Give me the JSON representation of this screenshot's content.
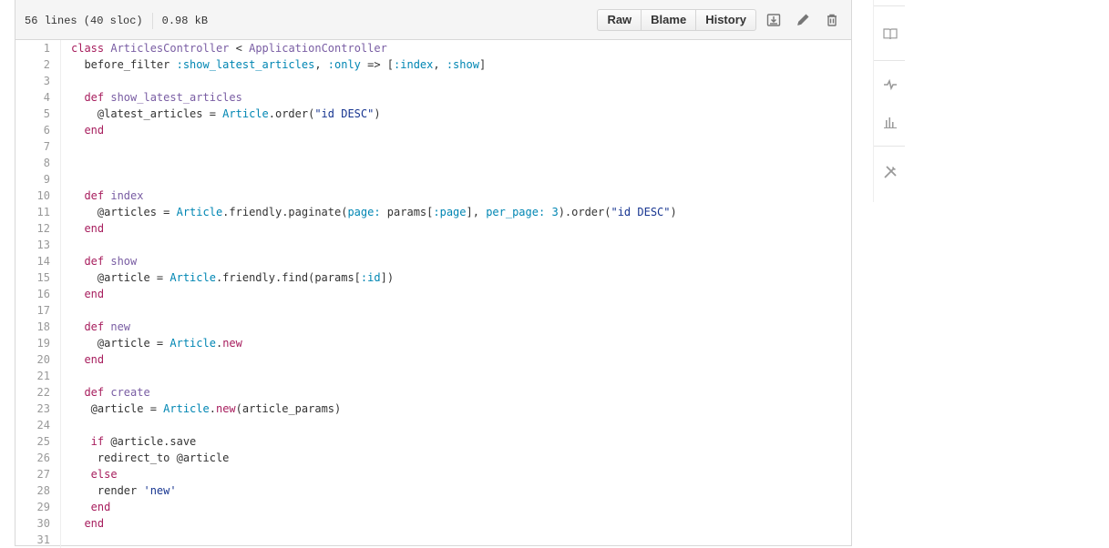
{
  "file_header": {
    "lines_info": "56 lines (40 sloc)",
    "size": "0.98 kB",
    "buttons": {
      "raw": "Raw",
      "blame": "Blame",
      "history": "History"
    },
    "icons": [
      "download-icon",
      "pencil-icon",
      "trash-icon"
    ]
  },
  "code_lines": [
    [
      [
        "k",
        "class "
      ],
      [
        "c",
        "ArticlesController"
      ],
      [
        "",
        " < "
      ],
      [
        "c",
        "ApplicationController"
      ]
    ],
    [
      [
        "",
        "  before_filter "
      ],
      [
        "con",
        ":show_latest_articles"
      ],
      [
        "",
        ", "
      ],
      [
        "con",
        ":only"
      ],
      [
        "",
        " => ["
      ],
      [
        "con",
        ":index"
      ],
      [
        "",
        ", "
      ],
      [
        "con",
        ":show"
      ],
      [
        "",
        "]"
      ]
    ],
    [],
    [
      [
        "k",
        "  def "
      ],
      [
        "c",
        "show_latest_articles"
      ]
    ],
    [
      [
        "",
        "    @latest_articles = "
      ],
      [
        "con",
        "Article"
      ],
      [
        "",
        ".order("
      ],
      [
        "s",
        "\"id DESC\""
      ],
      [
        "",
        ")"
      ]
    ],
    [
      [
        "k",
        "  end"
      ]
    ],
    [],
    [],
    [],
    [
      [
        "k",
        "  def "
      ],
      [
        "c",
        "index"
      ]
    ],
    [
      [
        "",
        "    @articles = "
      ],
      [
        "con",
        "Article"
      ],
      [
        "",
        ".friendly.paginate("
      ],
      [
        "con",
        "page:"
      ],
      [
        "",
        " params["
      ],
      [
        "con",
        ":page"
      ],
      [
        "",
        "], "
      ],
      [
        "con",
        "per_page:"
      ],
      [
        "",
        " "
      ],
      [
        "con",
        "3"
      ],
      [
        "",
        ").order("
      ],
      [
        "s",
        "\"id DESC\""
      ],
      [
        "",
        ")"
      ]
    ],
    [
      [
        "k",
        "  end"
      ]
    ],
    [],
    [
      [
        "k",
        "  def "
      ],
      [
        "c",
        "show"
      ]
    ],
    [
      [
        "",
        "    @article = "
      ],
      [
        "con",
        "Article"
      ],
      [
        "",
        ".friendly.find(params["
      ],
      [
        "con",
        ":id"
      ],
      [
        "",
        "])"
      ]
    ],
    [
      [
        "k",
        "  end"
      ]
    ],
    [],
    [
      [
        "k",
        "  def "
      ],
      [
        "c",
        "new"
      ]
    ],
    [
      [
        "",
        "    @article = "
      ],
      [
        "con",
        "Article"
      ],
      [
        "",
        "."
      ],
      [
        "k",
        "new"
      ]
    ],
    [
      [
        "k",
        "  end"
      ]
    ],
    [],
    [
      [
        "k",
        "  def "
      ],
      [
        "c",
        "create"
      ]
    ],
    [
      [
        "",
        "   @article = "
      ],
      [
        "con",
        "Article"
      ],
      [
        "",
        "."
      ],
      [
        "k",
        "new"
      ],
      [
        "",
        "(article_params)"
      ]
    ],
    [],
    [
      [
        "k",
        "   if "
      ],
      [
        "",
        "@article.save"
      ]
    ],
    [
      [
        "",
        "    redirect_to @article"
      ]
    ],
    [
      [
        "k",
        "   else"
      ]
    ],
    [
      [
        "",
        "    render "
      ],
      [
        "s",
        "'new'"
      ]
    ],
    [
      [
        "k",
        "   end"
      ]
    ],
    [
      [
        "k",
        "  end"
      ]
    ],
    []
  ],
  "side_rail": {
    "icons": [
      "wiki-icon",
      "pulse-icon",
      "graphs-icon",
      "settings-icon"
    ]
  },
  "colors": {
    "keyword": "#a71d5d",
    "class": "#795da3",
    "constant": "#0086b3",
    "string": "#183691"
  }
}
